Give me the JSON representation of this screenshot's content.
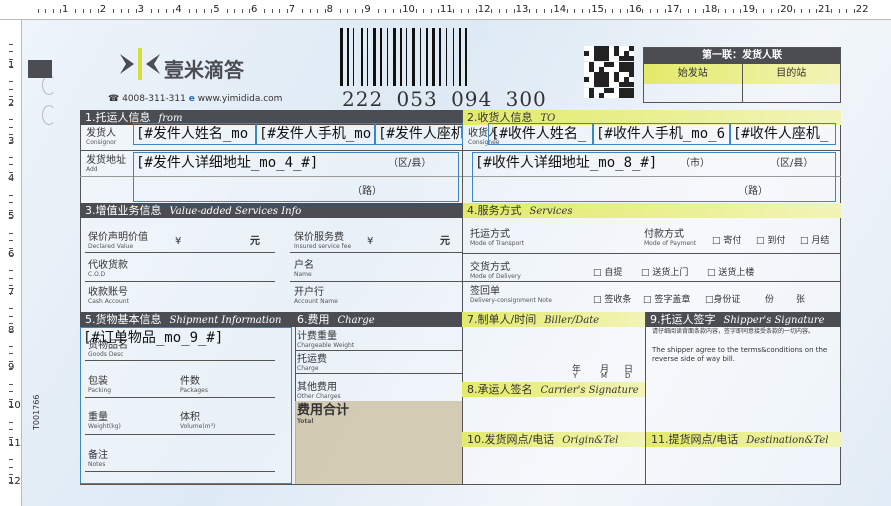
{
  "ruler": {
    "top": [
      "1",
      "2",
      "3",
      "4",
      "5",
      "6",
      "7",
      "8",
      "9",
      "10",
      "11",
      "12",
      "13",
      "14",
      "15",
      "16",
      "17",
      "18",
      "19",
      "20",
      "21",
      "22"
    ],
    "left": [
      "1",
      "2",
      "3",
      "4",
      "5",
      "6",
      "7",
      "8",
      "9",
      "10",
      "11",
      "12"
    ]
  },
  "header": {
    "brand": "壹米滴答",
    "phone": "4008-311-311",
    "website": "www.yimidida.com",
    "tracking_number": "222 053 094 300",
    "copy_title": "第一联：发货人联",
    "origin_label": "始发站",
    "destination_label": "目的站"
  },
  "form_code": "T001766",
  "sec1": {
    "title": "1.托运人信息",
    "title_en": "from",
    "consignor": "发货人",
    "consignor_en": "Consignor",
    "address": "发货地址",
    "address_en": "Add",
    "district": "（区/县）",
    "road": "（路）"
  },
  "sec2": {
    "title": "2.收货人信息",
    "title_en": "TO",
    "consignee": "收货人",
    "consignee_en": "Consignee",
    "city": "（市）",
    "district": "（区/县）",
    "road": "（路）"
  },
  "fields": {
    "sender_name": "[#发件人姓名_mo",
    "sender_mobile": "[#发件人手机_mo",
    "sender_phone": "[#发件人座机",
    "sender_address": "[#发件人详细地址_mo_4_#]",
    "receiver_name": "[#收件人姓名_",
    "receiver_mobile": "[#收件人手机_mo_6",
    "receiver_phone": "[#收件人座机_",
    "receiver_address": "[#收件人详细地址_mo_8_#]",
    "goods": "[#订单物品_mo_9_#]"
  },
  "sec3": {
    "title": "3.增值业务信息",
    "title_en": "Value-added Services Info",
    "declared": "保价声明价值",
    "declared_en": "Declared Value",
    "yen": "¥",
    "yuan": "元",
    "insured_fee": "保价服务费",
    "insured_fee_en": "Insured service fee",
    "cod": "代收货款",
    "cod_en": "C.O.D",
    "name": "户名",
    "name_en": "Name",
    "cash_account": "收款账号",
    "cash_account_en": "Cash Account",
    "bank": "开户行",
    "bank_en": "Account Name"
  },
  "sec4": {
    "title": "4.服务方式",
    "title_en": "Services",
    "transport": "托运方式",
    "transport_en": "Mode of Transport",
    "payment": "付款方式",
    "payment_en": "Mode of Payment",
    "pay_options": [
      "□ 寄付",
      "□ 到付",
      "□ 月结"
    ],
    "delivery": "交货方式",
    "delivery_en": "Mode of Delivery",
    "delivery_options": [
      "□ 自提",
      "□ 送货上门",
      "□ 送货上楼"
    ],
    "receipt": "签回单",
    "receipt_en": "Delivery-consignment Note",
    "receipt_options": [
      "□ 签收条",
      "□ 签字盖章",
      "□身份证",
      "份",
      "张"
    ]
  },
  "sec5": {
    "title": "5.货物基本信息",
    "title_en": "Shipment Information",
    "goods": "货物品名",
    "goods_en": "Goods Desc",
    "packing": "包装",
    "packing_en": "Packing",
    "packages": "件数",
    "packages_en": "Packages",
    "weight": "重量",
    "weight_en": "Weight(kg)",
    "volume": "体积",
    "volume_en": "Volume(m³)",
    "notes": "备注",
    "notes_en": "Notes"
  },
  "sec6": {
    "title": "6.费用",
    "title_en": "Charge",
    "chargeable": "计费重量",
    "chargeable_en": "Chargeable Weight",
    "charge": "托运费",
    "charge_en": "Charge",
    "other": "其他费用",
    "other_en": "Other Charges",
    "total": "费用合计",
    "total_en": "Total"
  },
  "sec7": {
    "title": "7.制单人/时间",
    "title_en": "Biller/Date",
    "year": "年",
    "month": "月",
    "day": "日",
    "y": "Y",
    "m": "M",
    "d": "D"
  },
  "sec8": {
    "title": "8.承运人签名",
    "title_en": "Carrier's Signature"
  },
  "sec9": {
    "title": "9.托运人签字",
    "title_en": "Shipper's Signature",
    "terms_cn": "请仔细阅读背面条款内容，签字即同意接受条款的一切内容。",
    "terms_en": "The shipper agree to the terms&conditions on the reverse side of way bill."
  },
  "sec10": {
    "title": "10.发货网点/电话",
    "title_en": "Origin&Tel"
  },
  "sec11": {
    "title": "11.提货网点/电话",
    "title_en": "Destination&Tel"
  }
}
